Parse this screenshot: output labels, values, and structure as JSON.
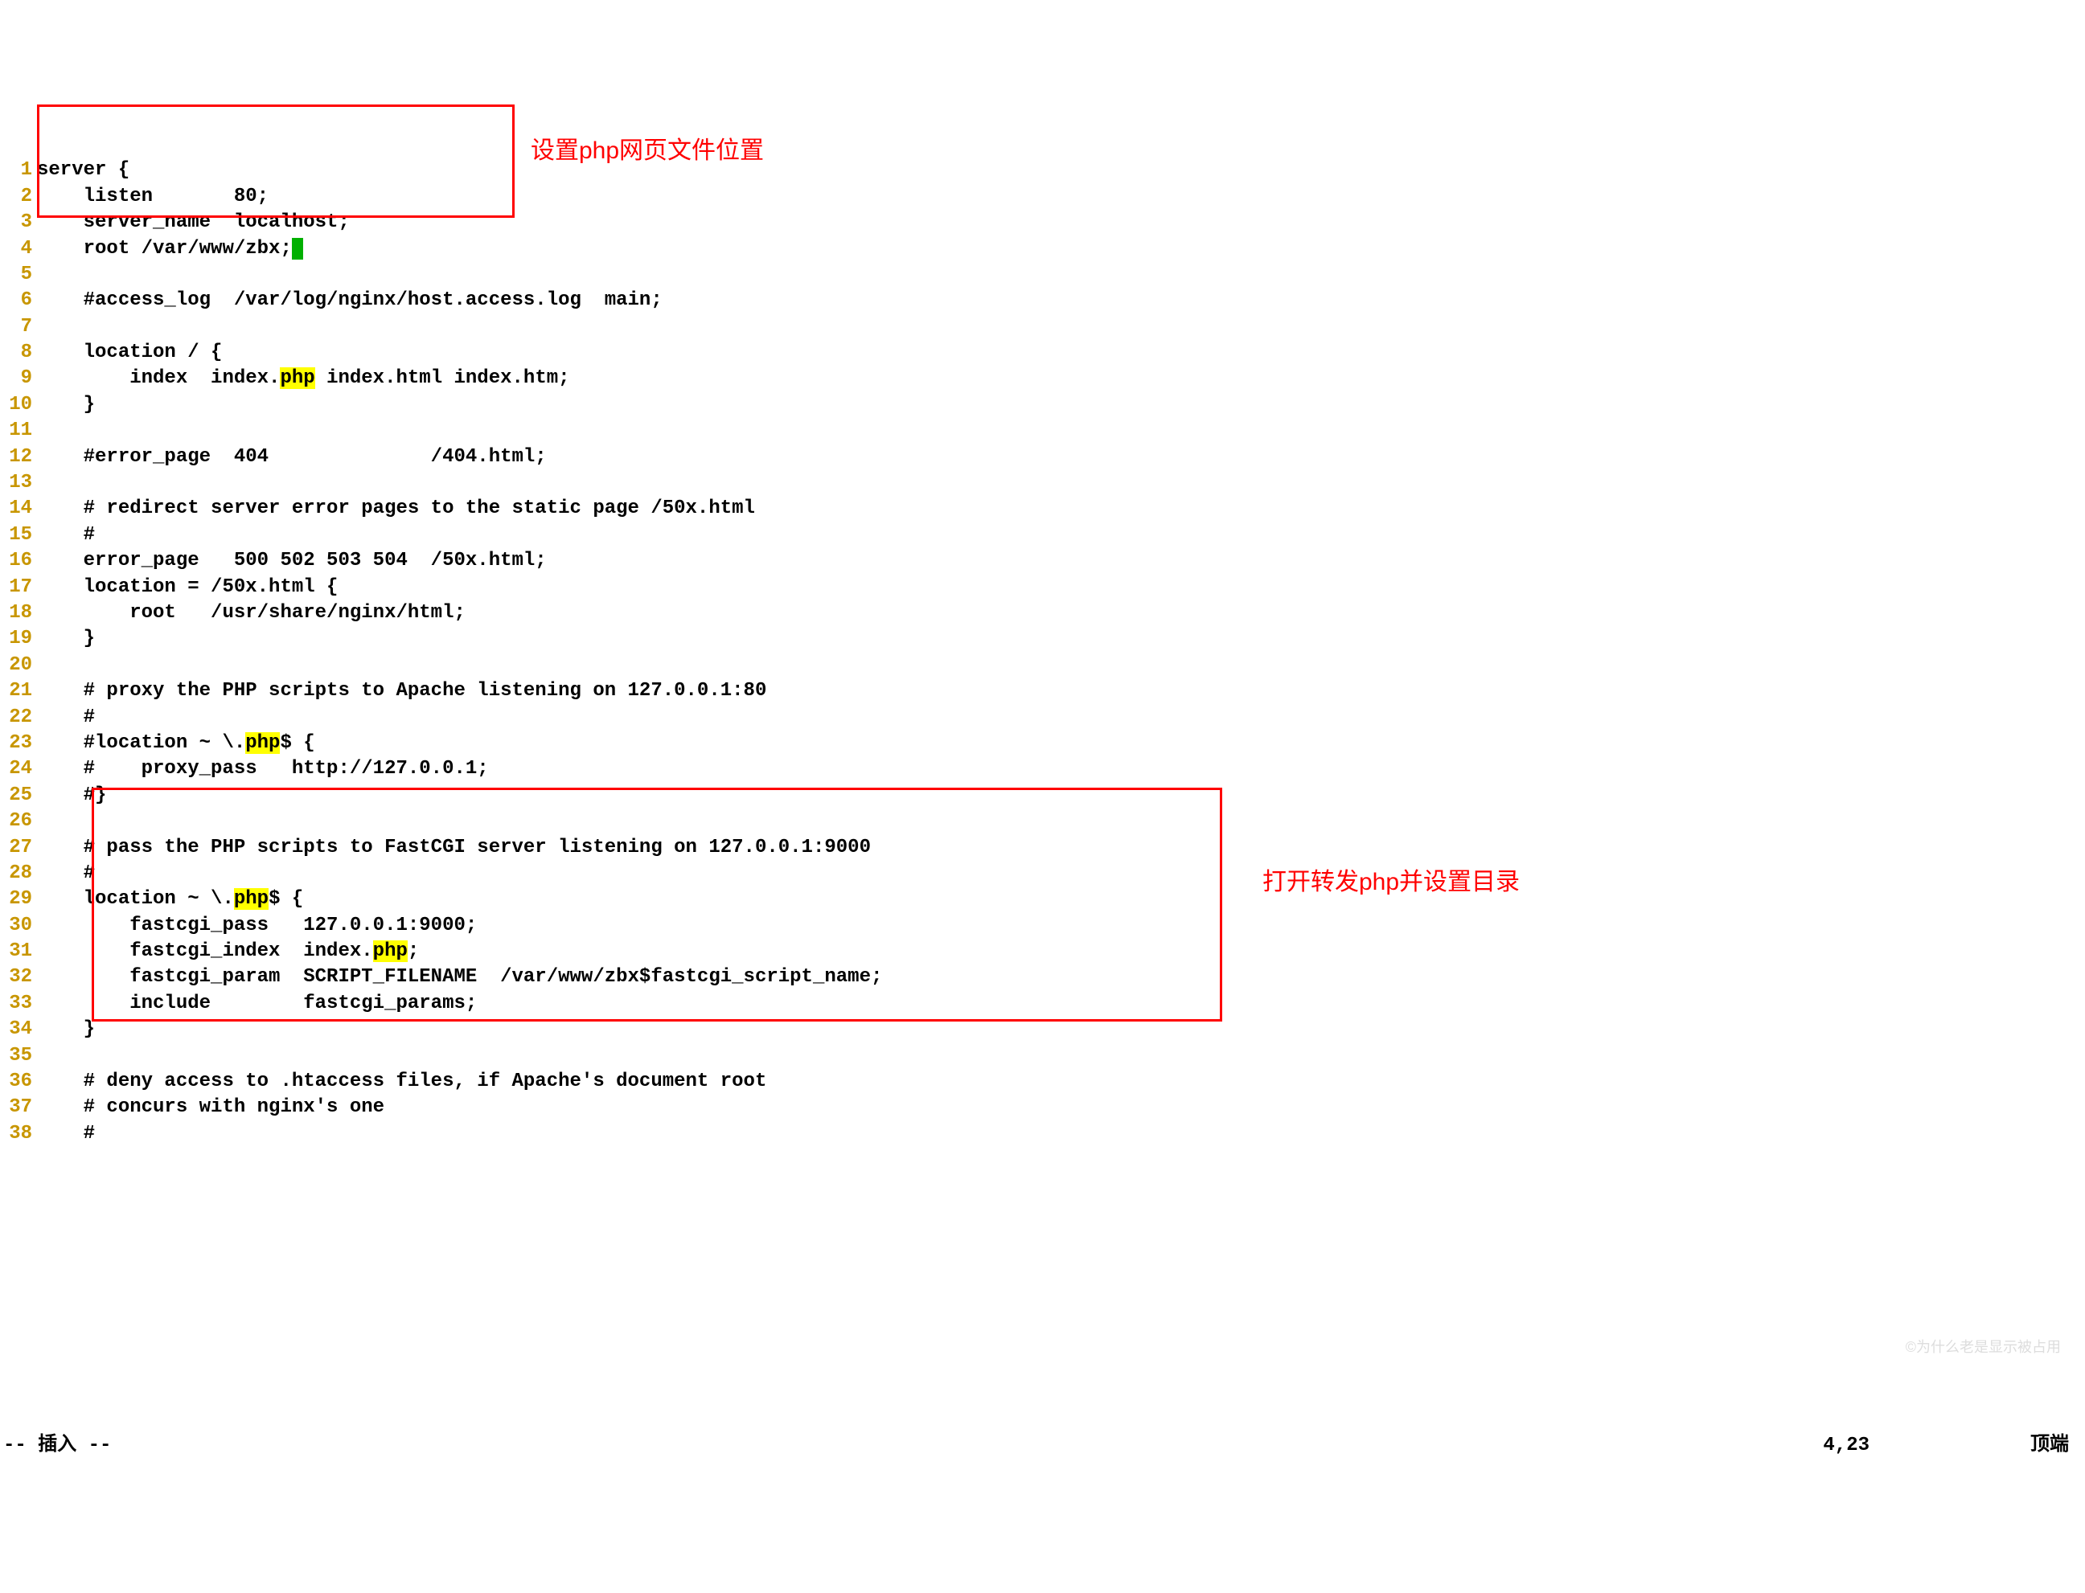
{
  "annotations": {
    "top": "设置php网页文件位置",
    "bottom": "打开转发php并设置目录"
  },
  "lines": [
    {
      "n": "1",
      "segs": [
        {
          "t": "server {"
        }
      ]
    },
    {
      "n": "2",
      "segs": [
        {
          "t": "    listen       80;"
        }
      ]
    },
    {
      "n": "3",
      "segs": [
        {
          "t": "    server_name  localhost;"
        }
      ]
    },
    {
      "n": "4",
      "segs": [
        {
          "t": "    root /var/www/zbx;"
        },
        {
          "cursor": true
        }
      ]
    },
    {
      "n": "5",
      "segs": [
        {
          "t": ""
        }
      ]
    },
    {
      "n": "6",
      "segs": [
        {
          "t": "    #access_log  /var/log/nginx/host.access.log  main;"
        }
      ]
    },
    {
      "n": "7",
      "segs": [
        {
          "t": ""
        }
      ]
    },
    {
      "n": "8",
      "segs": [
        {
          "t": "    location / {"
        }
      ]
    },
    {
      "n": "9",
      "segs": [
        {
          "t": "        index  index."
        },
        {
          "t": "php",
          "hl": true
        },
        {
          "t": " index.html index.htm;"
        }
      ]
    },
    {
      "n": "10",
      "segs": [
        {
          "t": "    }"
        }
      ]
    },
    {
      "n": "11",
      "segs": [
        {
          "t": ""
        }
      ]
    },
    {
      "n": "12",
      "segs": [
        {
          "t": "    #error_page  404              /404.html;"
        }
      ]
    },
    {
      "n": "13",
      "segs": [
        {
          "t": ""
        }
      ]
    },
    {
      "n": "14",
      "segs": [
        {
          "t": "    # redirect server error pages to the static page /50x.html"
        }
      ]
    },
    {
      "n": "15",
      "segs": [
        {
          "t": "    #"
        }
      ]
    },
    {
      "n": "16",
      "segs": [
        {
          "t": "    error_page   500 502 503 504  /50x.html;"
        }
      ]
    },
    {
      "n": "17",
      "segs": [
        {
          "t": "    location = /50x.html {"
        }
      ]
    },
    {
      "n": "18",
      "segs": [
        {
          "t": "        root   /usr/share/nginx/html;"
        }
      ]
    },
    {
      "n": "19",
      "segs": [
        {
          "t": "    }"
        }
      ]
    },
    {
      "n": "20",
      "segs": [
        {
          "t": ""
        }
      ]
    },
    {
      "n": "21",
      "segs": [
        {
          "t": "    # proxy the PHP scripts to Apache listening on 127.0.0.1:80"
        }
      ]
    },
    {
      "n": "22",
      "segs": [
        {
          "t": "    #"
        }
      ]
    },
    {
      "n": "23",
      "segs": [
        {
          "t": "    #location ~ \\."
        },
        {
          "t": "php",
          "hl": true
        },
        {
          "t": "$ {"
        }
      ]
    },
    {
      "n": "24",
      "segs": [
        {
          "t": "    #    proxy_pass   http://127.0.0.1;"
        }
      ]
    },
    {
      "n": "25",
      "segs": [
        {
          "t": "    #}"
        }
      ]
    },
    {
      "n": "26",
      "segs": [
        {
          "t": ""
        }
      ]
    },
    {
      "n": "27",
      "segs": [
        {
          "t": "    # pass the PHP scripts to FastCGI server listening on 127.0.0.1:9000"
        }
      ]
    },
    {
      "n": "28",
      "segs": [
        {
          "t": "    #"
        }
      ]
    },
    {
      "n": "29",
      "segs": [
        {
          "t": "    location ~ \\."
        },
        {
          "t": "php",
          "hl": true
        },
        {
          "t": "$ {"
        }
      ]
    },
    {
      "n": "30",
      "segs": [
        {
          "t": "        fastcgi_pass   127.0.0.1:9000;"
        }
      ]
    },
    {
      "n": "31",
      "segs": [
        {
          "t": "        fastcgi_index  index."
        },
        {
          "t": "php",
          "hl": true
        },
        {
          "t": ";"
        }
      ]
    },
    {
      "n": "32",
      "segs": [
        {
          "t": "        fastcgi_param  SCRIPT_FILENAME  /var/www/zbx$fastcgi_script_name;"
        }
      ]
    },
    {
      "n": "33",
      "segs": [
        {
          "t": "        include        fastcgi_params;"
        }
      ]
    },
    {
      "n": "34",
      "segs": [
        {
          "t": "    }"
        }
      ]
    },
    {
      "n": "35",
      "segs": [
        {
          "t": ""
        }
      ]
    },
    {
      "n": "36",
      "segs": [
        {
          "t": "    # deny access to .htaccess files, if Apache's document root"
        }
      ]
    },
    {
      "n": "37",
      "segs": [
        {
          "t": "    # concurs with nginx's one"
        }
      ]
    },
    {
      "n": "38",
      "segs": [
        {
          "t": "    #"
        }
      ]
    }
  ],
  "status": {
    "mode": "-- 插入 --",
    "pos": "4,23",
    "scroll": "顶端"
  },
  "watermark": "©为什么老是显示被占用"
}
